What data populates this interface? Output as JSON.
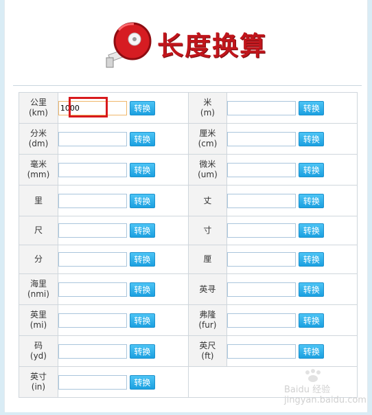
{
  "header": {
    "title": "长度换算"
  },
  "convert_label": "转换",
  "units": [
    {
      "label1": "公里",
      "label2": "(km)",
      "value": "1000"
    },
    {
      "label1": "米",
      "label2": "(m)",
      "value": ""
    },
    {
      "label1": "分米",
      "label2": "(dm)",
      "value": ""
    },
    {
      "label1": "厘米",
      "label2": "(cm)",
      "value": ""
    },
    {
      "label1": "毫米",
      "label2": "(mm)",
      "value": ""
    },
    {
      "label1": "微米",
      "label2": "(um)",
      "value": ""
    },
    {
      "label1": "里",
      "label2": "",
      "value": ""
    },
    {
      "label1": "丈",
      "label2": "",
      "value": ""
    },
    {
      "label1": "尺",
      "label2": "",
      "value": ""
    },
    {
      "label1": "寸",
      "label2": "",
      "value": ""
    },
    {
      "label1": "分",
      "label2": "",
      "value": ""
    },
    {
      "label1": "厘",
      "label2": "",
      "value": ""
    },
    {
      "label1": "海里",
      "label2": "(nmi)",
      "value": ""
    },
    {
      "label1": "英寻",
      "label2": "",
      "value": ""
    },
    {
      "label1": "英里",
      "label2": "(mi)",
      "value": ""
    },
    {
      "label1": "弗隆",
      "label2": "(fur)",
      "value": ""
    },
    {
      "label1": "码",
      "label2": "(yd)",
      "value": ""
    },
    {
      "label1": "英尺",
      "label2": "(ft)",
      "value": ""
    },
    {
      "label1": "英寸",
      "label2": "(in)",
      "value": ""
    }
  ],
  "watermark": "Baidu 经验 jingyan.baidu.com",
  "colors": {
    "accent": "#1ba0e0",
    "brand": "#c0151b",
    "highlight": "#d8191c"
  }
}
